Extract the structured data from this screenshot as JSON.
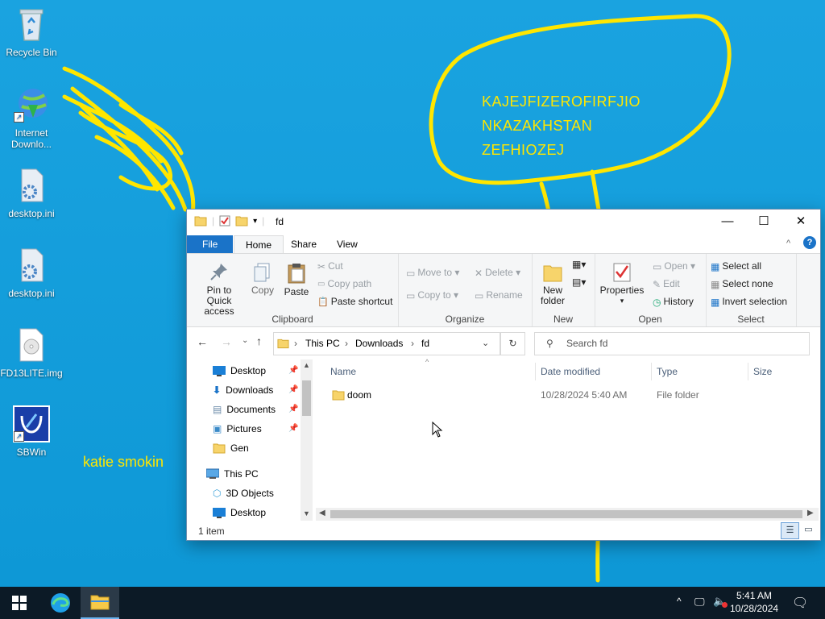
{
  "desktop": {
    "icons": [
      {
        "label": "Recycle Bin",
        "icon": "recycle-bin-icon"
      },
      {
        "label": "Internet Downlo...",
        "icon": "idm-icon"
      },
      {
        "label": "desktop.ini",
        "icon": "settings-file-icon"
      },
      {
        "label": "desktop.ini",
        "icon": "settings-file-icon"
      },
      {
        "label": "FD13LITE.img",
        "icon": "disc-image-icon"
      },
      {
        "label": "SBWin",
        "icon": "sbwin-icon"
      }
    ],
    "bubble_lines": [
      "KAJEJFIZEROFIRFJIO",
      "NKAZAKHSTAN",
      "ZEFHIOZEJ"
    ],
    "scribble_text": "katie smokin",
    "doodle_color": "#ffe600"
  },
  "window": {
    "title": "fd",
    "ribbon_tabs": [
      "File",
      "Home",
      "Share",
      "View"
    ],
    "clipboard": {
      "pin": "Pin to Quick access",
      "copy": "Copy",
      "paste": "Paste",
      "cut": "Cut",
      "copy_path": "Copy path",
      "paste_shortcut": "Paste shortcut",
      "label": "Clipboard"
    },
    "organize": {
      "move_to": "Move to",
      "copy_to": "Copy to",
      "delete": "Delete",
      "rename": "Rename",
      "label": "Organize"
    },
    "new": {
      "new_folder_line1": "New",
      "new_folder_line2": "folder",
      "label": "New"
    },
    "open": {
      "properties": "Properties",
      "open": "Open",
      "edit": "Edit",
      "history": "History",
      "label": "Open"
    },
    "select": {
      "select_all": "Select all",
      "select_none": "Select none",
      "invert": "Invert selection",
      "label": "Select"
    },
    "breadcrumb": [
      "This PC",
      "Downloads",
      "fd"
    ],
    "search_placeholder": "Search fd",
    "nav": {
      "quick": [
        {
          "label": "Desktop",
          "pinned": true
        },
        {
          "label": "Downloads",
          "pinned": true
        },
        {
          "label": "Documents",
          "pinned": true
        },
        {
          "label": "Pictures",
          "pinned": true
        },
        {
          "label": "Gen",
          "pinned": false
        }
      ],
      "this_pc": "This PC",
      "pc_items": [
        "3D Objects",
        "Desktop"
      ]
    },
    "columns": [
      "Name",
      "Date modified",
      "Type",
      "Size"
    ],
    "files": [
      {
        "name": "doom",
        "date": "10/28/2024 5:40 AM",
        "type": "File folder",
        "size": ""
      }
    ],
    "status": "1 item"
  },
  "taskbar": {
    "time": "5:41 AM",
    "date": "10/28/2024"
  }
}
